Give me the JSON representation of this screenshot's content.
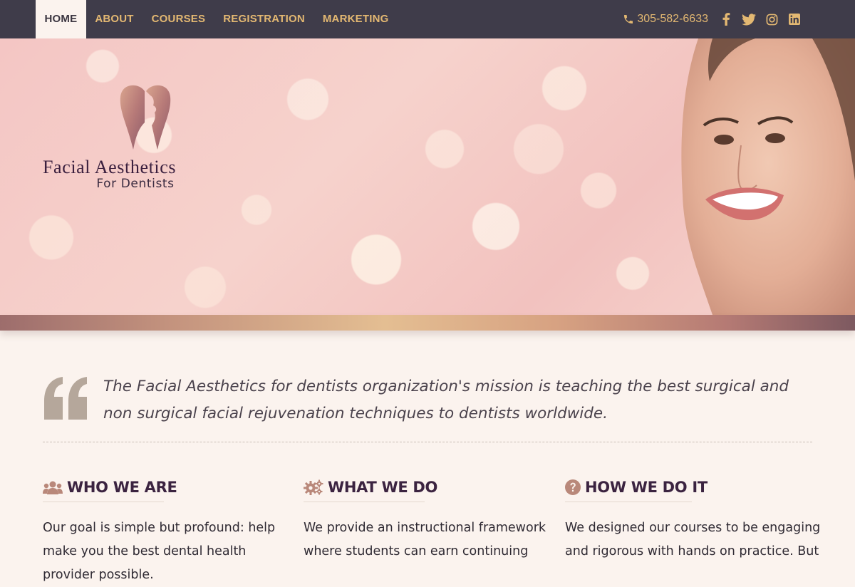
{
  "nav": {
    "items": [
      {
        "label": "HOME",
        "active": true
      },
      {
        "label": "ABOUT",
        "active": false
      },
      {
        "label": "COURSES",
        "active": false
      },
      {
        "label": "REGISTRATION",
        "active": false
      },
      {
        "label": "MARKETING",
        "active": false
      }
    ],
    "phone": "305-582-6633",
    "social_icons": [
      "facebook-icon",
      "twitter-icon",
      "instagram-icon",
      "linkedin-icon"
    ]
  },
  "hero": {
    "logo_title": "Facial Aesthetics",
    "logo_subtitle": "For Dentists"
  },
  "mission": {
    "quote": "The Facial Aesthetics for dentists organization's mission is teaching the best surgical and non surgical facial rejuvenation techniques to dentists worldwide."
  },
  "columns": [
    {
      "title": "WHO WE ARE",
      "icon": "users-icon",
      "text": "Our goal is simple but profound: help make you the best dental health provider possible."
    },
    {
      "title": "WHAT WE DO",
      "icon": "gears-icon",
      "text": "We provide an instructional framework where students can earn continuing"
    },
    {
      "title": "HOW WE DO IT",
      "icon": "question-circle-icon",
      "text": "We designed our courses to be engaging and rigorous with hands on practice. But"
    }
  ],
  "colors": {
    "nav_bg": "#3f3c4a",
    "nav_text": "#e3b872",
    "heading": "#3b2340",
    "page_bg": "#fbf3ee"
  }
}
